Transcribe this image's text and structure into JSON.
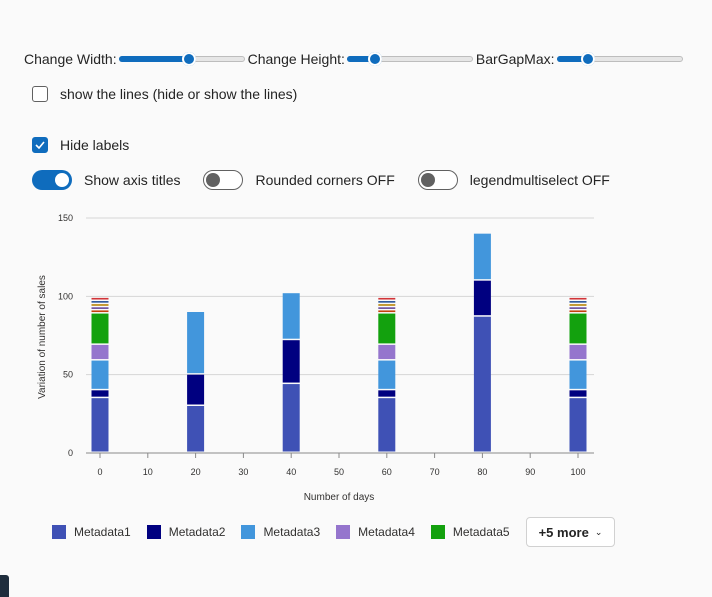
{
  "controls": {
    "width_label": "Change Width:",
    "width_value": 0.56,
    "height_label": "Change Height:",
    "height_value": 0.22,
    "bargap_label": "BarGapMax:",
    "bargap_value": 0.25,
    "lines_label": "show the lines (hide or show the lines)",
    "lines_checked": false,
    "hide_labels_label": "Hide labels",
    "hide_labels_checked": true,
    "axis_titles_label": "Show axis titles",
    "axis_titles_on": true,
    "rounded_label": "Rounded corners OFF",
    "rounded_on": false,
    "multiselect_label": "legendmultiselect OFF",
    "multiselect_on": false
  },
  "legend": {
    "more_label": "+5 more"
  },
  "colors": {
    "accent": "#0f6cbd",
    "metadata1": "#3f51b5",
    "metadata2": "#000080",
    "metadata3": "#4296dc",
    "metadata4": "#9575cd",
    "metadata5": "#13a10e"
  },
  "chart_data": {
    "type": "bar",
    "stacked": true,
    "xlabel": "Number of days",
    "ylabel": "Variation of number of sales",
    "xlim": [
      0,
      100
    ],
    "ylim": [
      0,
      150
    ],
    "xticks": [
      0,
      10,
      20,
      30,
      40,
      50,
      60,
      70,
      80,
      90,
      100
    ],
    "yticks": [
      0,
      50,
      100,
      150
    ],
    "grid": true,
    "legend_position": "bottom-left",
    "x": [
      0,
      20,
      40,
      60,
      80,
      100
    ],
    "series": [
      {
        "name": "Metadata1",
        "color": "#3f51b5",
        "values": [
          35,
          30,
          44,
          35,
          87,
          35
        ]
      },
      {
        "name": "Metadata2",
        "color": "#000080",
        "values": [
          5,
          20,
          28,
          5,
          23,
          5
        ]
      },
      {
        "name": "Metadata3",
        "color": "#4296dc",
        "values": [
          19,
          40,
          30,
          19,
          30,
          19
        ]
      },
      {
        "name": "Metadata4",
        "color": "#9575cd",
        "values": [
          10,
          0,
          0,
          10,
          0,
          10
        ]
      },
      {
        "name": "Metadata5",
        "color": "#13a10e",
        "values": [
          20,
          0,
          0,
          20,
          0,
          20
        ]
      },
      {
        "color": "#c2410c",
        "values": [
          2,
          0,
          0,
          2,
          0,
          2
        ]
      },
      {
        "color": "#6b4e9b",
        "values": [
          2,
          0,
          0,
          2,
          0,
          2
        ]
      },
      {
        "color": "#b8860b",
        "values": [
          2,
          0,
          0,
          2,
          0,
          2
        ]
      },
      {
        "color": "#2b579a",
        "values": [
          2,
          0,
          0,
          2,
          0,
          2
        ]
      },
      {
        "color": "#d13438",
        "values": [
          2,
          0,
          0,
          2,
          0,
          2
        ]
      }
    ]
  }
}
